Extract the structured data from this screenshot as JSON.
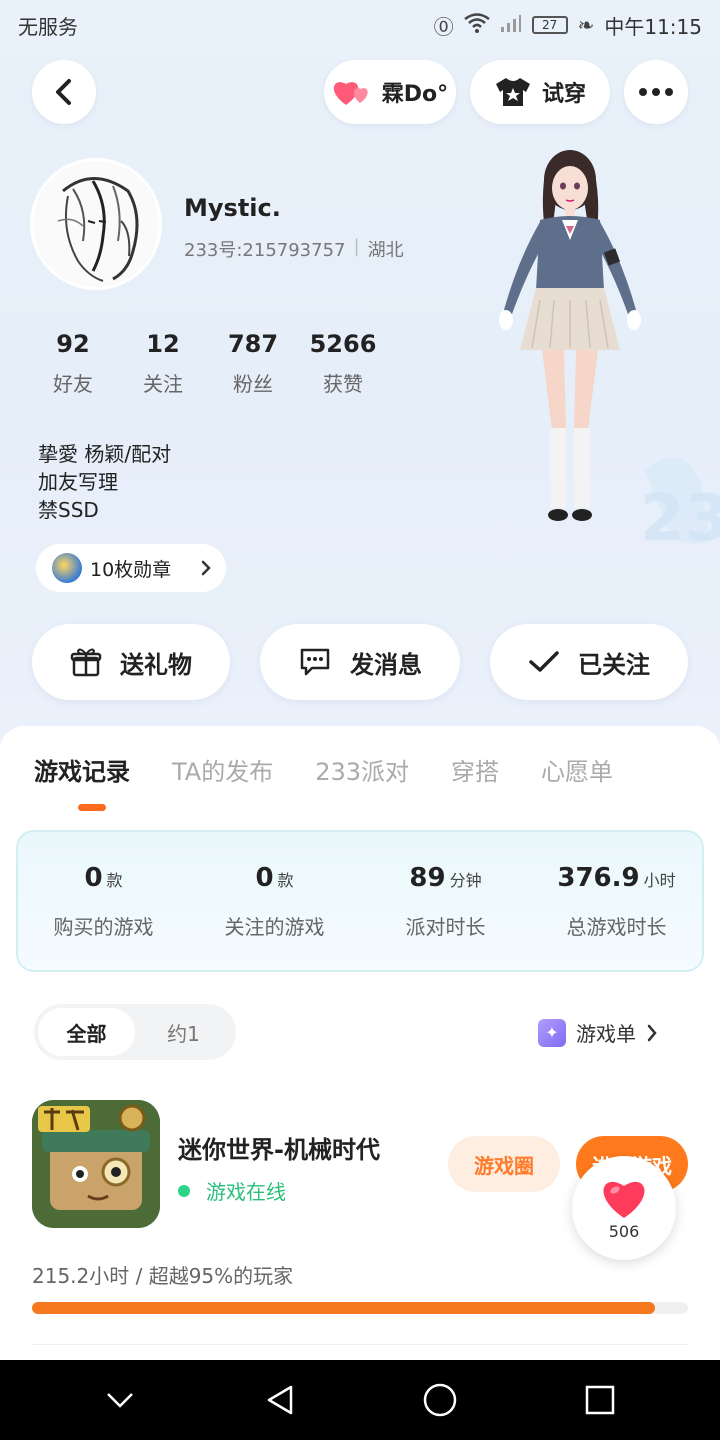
{
  "status_bar": {
    "carrier": "无服务",
    "battery": "27",
    "time": "中午11:15"
  },
  "header": {
    "like_label": "霖Do°",
    "try_label": "试穿"
  },
  "profile": {
    "name": "Mystic.",
    "id_text": "233号:215793757",
    "separator": "|",
    "region": "湖北",
    "stats": [
      {
        "value": "92",
        "label": "好友"
      },
      {
        "value": "12",
        "label": "关注"
      },
      {
        "value": "787",
        "label": "粉丝"
      },
      {
        "value": "5266",
        "label": "获赞"
      }
    ],
    "bio": [
      "挚愛 杨颖/配对",
      "加友写理",
      "禁SSD"
    ],
    "badge_text": "10枚勋章"
  },
  "actions": {
    "gift": "送礼物",
    "message": "发消息",
    "follow": "已关注"
  },
  "tabs": [
    "游戏记录",
    "TA的发布",
    "233派对",
    "穿搭",
    "心愿单"
  ],
  "active_tab": 0,
  "summary": [
    {
      "num": "0",
      "unit": "款",
      "label": "购买的游戏"
    },
    {
      "num": "0",
      "unit": "款",
      "label": "关注的游戏"
    },
    {
      "num": "89",
      "unit": "分钟",
      "label": "派对时长"
    },
    {
      "num": "376.9",
      "unit": "小时",
      "label": "总游戏时长"
    }
  ],
  "filter": {
    "all": "全部",
    "date": "约1"
  },
  "game_list_link": "游戏单",
  "game": {
    "title": "迷你世界-机械时代",
    "status": "游戏在线",
    "circle_label": "游戏圈",
    "play_label": "进入游戏",
    "playtime": "215.2小时 / 超越95%的玩家",
    "progress_fraction": 0.95
  },
  "floating_like": {
    "count": "506"
  },
  "colors": {
    "accent": "#ff7a1c",
    "online": "#2bd585",
    "like": "#ff3b5c"
  }
}
